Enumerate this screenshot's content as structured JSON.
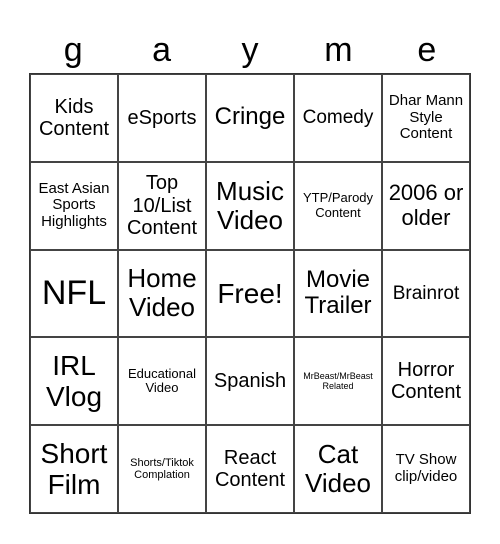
{
  "title_letters": [
    "g",
    "a",
    "y",
    "m",
    "e"
  ],
  "cells": [
    "Kids Content",
    "eSports",
    "Cringe",
    "Comedy",
    "Dhar Mann Style Content",
    "East Asian Sports Highlights",
    "Top 10/List Content",
    "Music Video",
    "YTP/Parody Content",
    "2006 or older",
    "NFL",
    "Home Video",
    "Free!",
    "Movie Trailer",
    "Brainrot",
    "IRL Vlog",
    "Educational Video",
    "Spanish",
    "MrBeast/MrBeast Related",
    "Horror Content",
    "Short Film",
    "Shorts/Tiktok Complation",
    "React Content",
    "Cat Video",
    "TV Show clip/video"
  ]
}
